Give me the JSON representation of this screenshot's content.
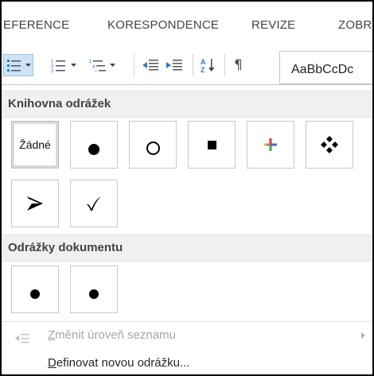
{
  "ribbon": {
    "tabs": [
      "EFERENCE",
      "KORESPONDENCE",
      "REVIZE",
      "ZOBR"
    ]
  },
  "toolbar": {
    "styles_sample": "AaBbCcDc",
    "icons": [
      "bullets-icon",
      "numbering-icon",
      "multilevel-list-icon",
      "decrease-indent-icon",
      "increase-indent-icon",
      "sort-icon",
      "pilcrow-icon"
    ]
  },
  "bullet_menu": {
    "library_header": "Knihovna odrážek",
    "library_items": [
      {
        "name": "none",
        "label": "Žádné",
        "selected": true
      },
      {
        "name": "filled-circle"
      },
      {
        "name": "hollow-circle"
      },
      {
        "name": "filled-square"
      },
      {
        "name": "four-color-cross"
      },
      {
        "name": "four-diamonds"
      },
      {
        "name": "arrowhead"
      },
      {
        "name": "checkmark"
      }
    ],
    "document_header": "Odrážky dokumentu",
    "document_items": [
      {
        "name": "filled-circle"
      },
      {
        "name": "filled-circle"
      }
    ],
    "change_level": {
      "accel": "Z",
      "rest": "měnit úroveň seznamu",
      "enabled": false
    },
    "define_new": {
      "accel": "D",
      "rest": "efinovat novou odrážku..."
    }
  },
  "colors": {
    "selected_tile_bg": "#dadada",
    "header_bg": "#f0f0f0",
    "bullets_icon_accent": "#2b7cd3",
    "disabled_text": "#a6a6a6"
  }
}
